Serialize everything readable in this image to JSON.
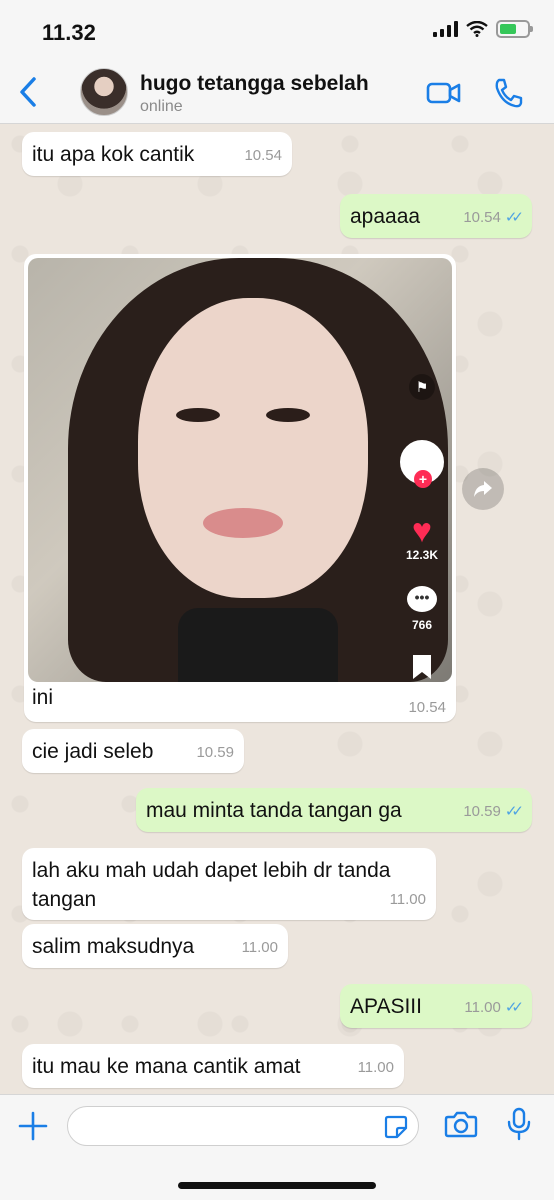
{
  "status_bar": {
    "time": "11.32"
  },
  "header": {
    "name": "hugo tetangga sebelah",
    "status": "online"
  },
  "messages": [
    {
      "text": "itu apa kok cantik",
      "time": "10.54"
    },
    {
      "text": "apaaaa",
      "time": "10.54"
    },
    {
      "text": "ini",
      "time": "10.54",
      "side_likes": "12.3K",
      "side_comments": "766"
    },
    {
      "text": "cie jadi seleb",
      "time": "10.59"
    },
    {
      "text": "mau minta tanda tangan ga",
      "time": "10.59"
    },
    {
      "text": "lah aku mah udah dapet lebih dr tanda tangan",
      "time": "11.00"
    },
    {
      "text": "salim maksudnya",
      "time": "11.00"
    },
    {
      "text": "APASIII",
      "time": "11.00"
    },
    {
      "text": "itu mau ke mana cantik amat",
      "time": "11.00"
    }
  ],
  "input": {
    "placeholder": ""
  },
  "colors": {
    "accent": "#1a7ee6",
    "outgoing": "#dcf8c6",
    "incoming": "#ffffff",
    "read_ticks": "#4fa3e3"
  },
  "icons": [
    "back-chevron-icon",
    "video-call-icon",
    "phone-icon",
    "forward-icon",
    "plus-icon",
    "sticker-icon",
    "camera-icon",
    "microphone-icon"
  ]
}
